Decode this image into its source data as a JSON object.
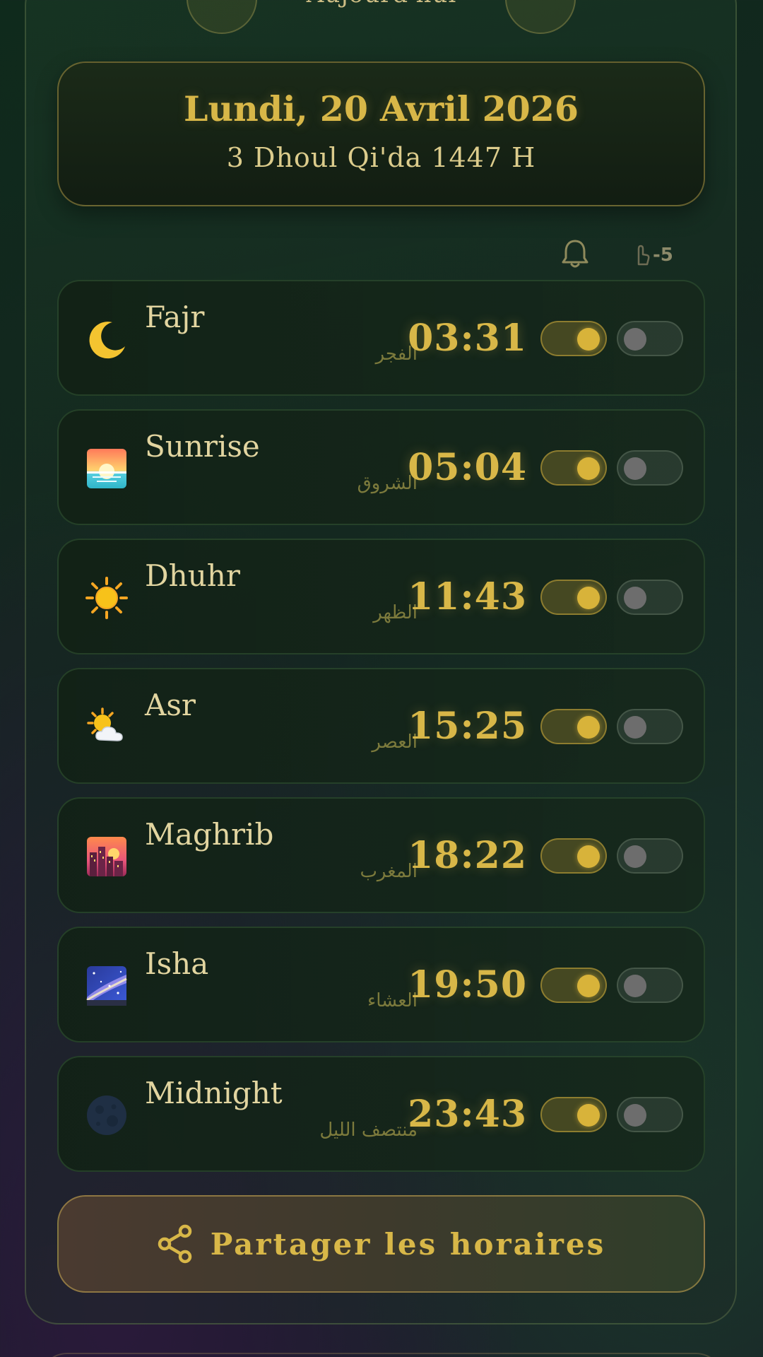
{
  "nav": {
    "prev_glyph": "‹",
    "label": "Aujourd'hui",
    "next_glyph": "›"
  },
  "date": {
    "gregorian": "Lundi, 20 Avril 2026",
    "hijri": "3 Dhoul Qi'da 1447 H"
  },
  "columns": {
    "notification_icon": "bell-icon",
    "adjust_icon": "hand-pointer-icon",
    "adjust_value": "-5"
  },
  "prayers": [
    {
      "name": "Fajr",
      "arabic": "الفجر",
      "time": "03:31",
      "icon": "crescent-moon-icon",
      "notify": true,
      "adjust": false
    },
    {
      "name": "Sunrise",
      "arabic": "الشروق",
      "time": "05:04",
      "icon": "sunrise-icon",
      "notify": true,
      "adjust": false
    },
    {
      "name": "Dhuhr",
      "arabic": "الظهر",
      "time": "11:43",
      "icon": "sun-icon",
      "notify": true,
      "adjust": false
    },
    {
      "name": "Asr",
      "arabic": "العصر",
      "time": "15:25",
      "icon": "sun-behind-cloud-icon",
      "notify": true,
      "adjust": false
    },
    {
      "name": "Maghrib",
      "arabic": "المغرب",
      "time": "18:22",
      "icon": "city-sunset-icon",
      "notify": true,
      "adjust": false
    },
    {
      "name": "Isha",
      "arabic": "العشاء",
      "time": "19:50",
      "icon": "milky-way-icon",
      "notify": true,
      "adjust": false
    },
    {
      "name": "Midnight",
      "arabic": "منتصف الليل",
      "time": "23:43",
      "icon": "new-moon-icon",
      "notify": true,
      "adjust": false
    }
  ],
  "share": {
    "label": "Partager les horaires",
    "icon": "share-icon"
  },
  "colors": {
    "accent_gold": "#d8b748",
    "text_cream": "#e2d5a0",
    "arabic_olive": "#7c7a3c"
  }
}
